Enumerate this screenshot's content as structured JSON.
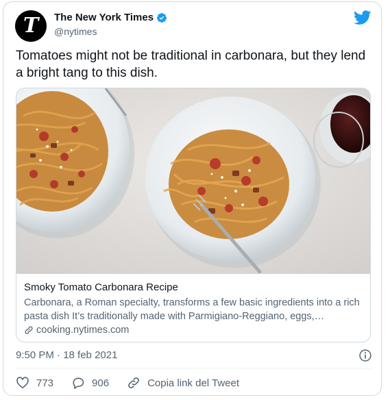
{
  "account": {
    "display_name": "The New York Times",
    "handle": "@nytimes",
    "avatar_glyph": "T"
  },
  "tweet": {
    "text": "Tomatoes might not be traditional in carbonara, but they lend a bright tang to this dish."
  },
  "card": {
    "image_icon": "carbonara-photo",
    "title": "Smoky Tomato Carbonara Recipe",
    "description": "Carbonara, a Roman specialty, transforms a few basic ingredients into a rich pasta dish It’s traditionally made with Parmigiano-Reggiano, eggs,…",
    "link": "cooking.nytimes.com"
  },
  "meta": {
    "timestamp": "9:50 PM · 18 feb 2021"
  },
  "actions": {
    "likes": "773",
    "replies": "906",
    "copy_link": "Copia link del Tweet"
  },
  "colors": {
    "verified": "#1d9bf0",
    "twitter": "#1d9bf0",
    "muted": "#536471"
  },
  "icons": [
    "verified-icon",
    "twitter-icon",
    "link-icon",
    "info-icon",
    "heart-icon",
    "reply-icon",
    "copy-link-icon"
  ]
}
